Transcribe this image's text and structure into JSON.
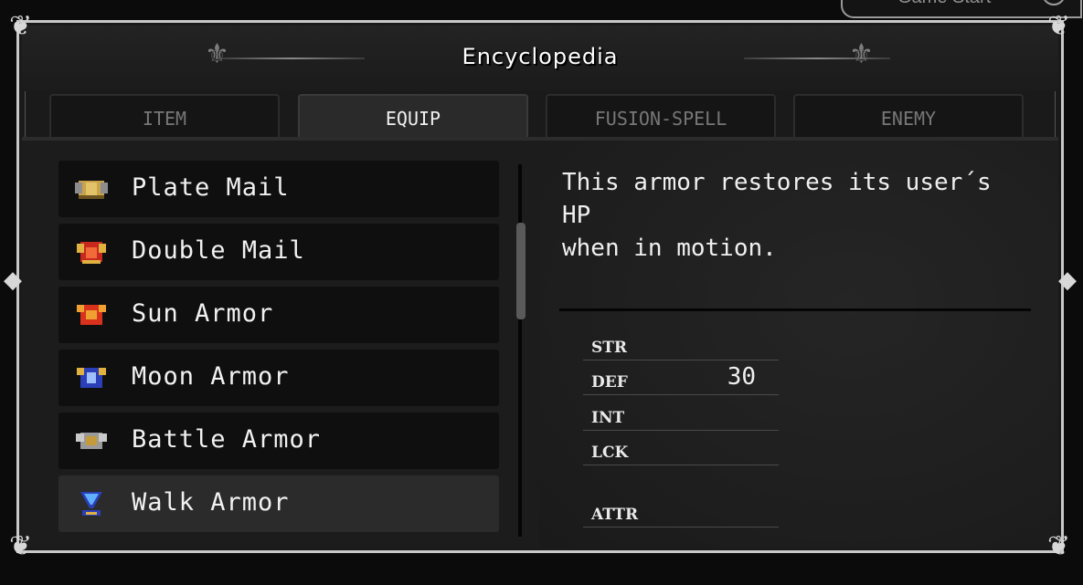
{
  "top_button": {
    "label": "Game Start"
  },
  "window": {
    "title": "Encyclopedia"
  },
  "tabs": [
    {
      "label": "ITEM",
      "active": false
    },
    {
      "label": "EQUIP",
      "active": true
    },
    {
      "label": "FUSION-SPELL",
      "active": false
    },
    {
      "label": "ENEMY",
      "active": false
    }
  ],
  "items": [
    {
      "name": "Plate Mail",
      "icon": "plate-mail-icon"
    },
    {
      "name": "Double Mail",
      "icon": "double-mail-icon"
    },
    {
      "name": "Sun Armor",
      "icon": "sun-armor-icon"
    },
    {
      "name": "Moon Armor",
      "icon": "moon-armor-icon"
    },
    {
      "name": "Battle Armor",
      "icon": "battle-armor-icon"
    },
    {
      "name": "Walk Armor",
      "icon": "walk-armor-icon",
      "selected": true
    }
  ],
  "detail": {
    "description": "This armor restores its user´s HP\nwhen in motion.",
    "stats": [
      {
        "label": "STR",
        "value": ""
      },
      {
        "label": "DEF",
        "value": "30"
      },
      {
        "label": "INT",
        "value": ""
      },
      {
        "label": "LCK",
        "value": ""
      },
      {
        "label": "ATTR",
        "value": ""
      }
    ]
  },
  "colors": {
    "frame": "#c9c9c9",
    "tab_active": "#2a2a2a",
    "item_bg": "#0f0f0f",
    "item_selected": "#2b2b2b"
  }
}
